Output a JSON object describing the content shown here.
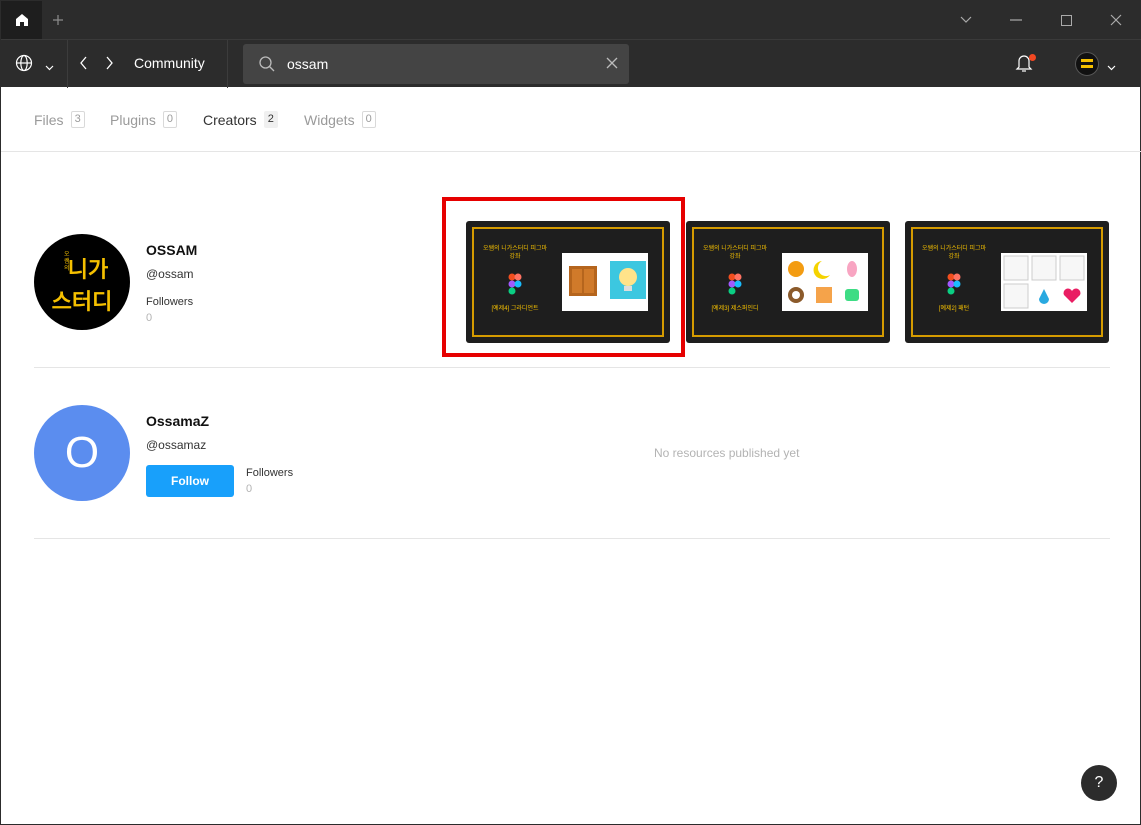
{
  "toolbar": {
    "title": "Community",
    "search_value": "ossam"
  },
  "tabs": [
    {
      "label": "Files",
      "count": "3"
    },
    {
      "label": "Plugins",
      "count": "0"
    },
    {
      "label": "Creators",
      "count": "2"
    },
    {
      "label": "Widgets",
      "count": "0"
    }
  ],
  "creators": [
    {
      "name": "OSSAM",
      "handle": "@ossam",
      "followers_label": "Followers",
      "followers_count": "0",
      "avatar_text": [
        "니가",
        "스터디"
      ],
      "avatar_side_text": "오쌤의"
    },
    {
      "name": "OssamaZ",
      "handle": "@ossamaz",
      "avatar_letter": "O",
      "follow_label": "Follow",
      "followers_label": "Followers",
      "followers_count": "0",
      "empty_note": "No resources published yet"
    }
  ],
  "thumbnails": [
    {
      "title": "오쌤의 니가스터디 피그마 강좌",
      "sub": "[예제4] 그라디언트"
    },
    {
      "title": "오쌤의 니가스터디 피그마 강좌",
      "sub": "[예제3] 제스퍼인디"
    },
    {
      "title": "오쌤의 니가스터디 피그마 강좌",
      "sub": "[예제2] 패턴"
    }
  ],
  "help_label": "?",
  "colors": {
    "titlebar": "#2c2c2c",
    "accent": "#18a0fb",
    "highlight": "#e60000",
    "brand_yellow": "#f5c000"
  }
}
